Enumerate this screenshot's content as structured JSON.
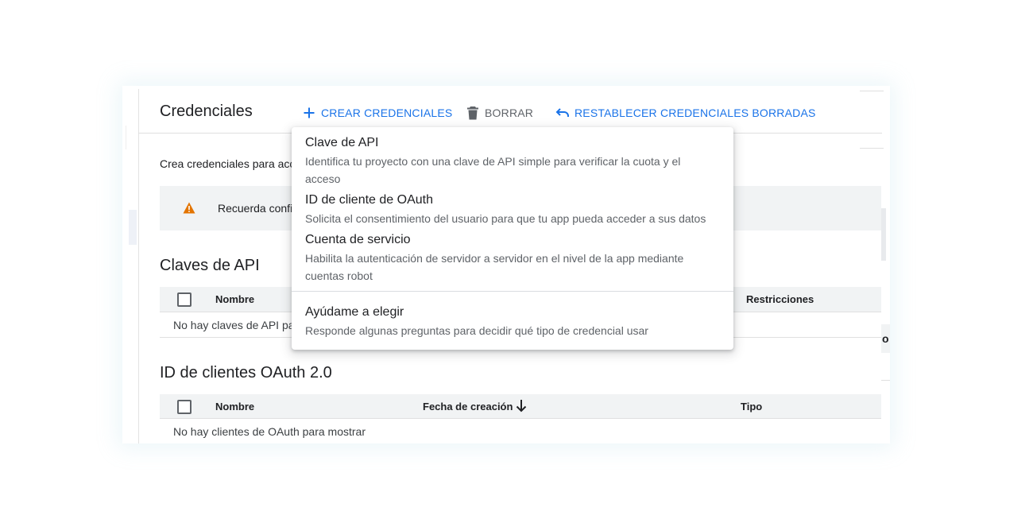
{
  "header": {
    "title": "Credenciales",
    "create_label": "CREAR CREDENCIALES",
    "delete_label": "BORRAR",
    "restore_label": "RESTABLECER CREDENCIALES BORRADAS"
  },
  "intro_text": "Crea credenciales para acc",
  "banner": {
    "text": "Recuerda confi"
  },
  "api_keys": {
    "title": "Claves de API",
    "col_name": "Nombre",
    "col_restrictions": "Restricciones",
    "empty": "No hay claves de API pa",
    "edge_char": "o"
  },
  "oauth": {
    "title": "ID de clientes OAuth 2.0",
    "col_name": "Nombre",
    "col_date": "Fecha de creación",
    "col_type": "Tipo",
    "empty": "No hay clientes de OAuth para mostrar"
  },
  "menu": {
    "items": [
      {
        "title": "Clave de API",
        "desc": "Identifica tu proyecto con una clave de API simple para verificar la cuota y el acceso"
      },
      {
        "title": "ID de cliente de OAuth",
        "desc": "Solicita el consentimiento del usuario para que tu app pueda acceder a sus datos"
      },
      {
        "title": "Cuenta de servicio",
        "desc": "Habilita la autenticación de servidor a servidor en el nivel de la app mediante cuentas robot"
      },
      {
        "title": "Ayúdame a elegir",
        "desc": "Responde algunas preguntas para decidir qué tipo de credencial usar"
      }
    ]
  },
  "colors": {
    "accent": "#1a73e8",
    "warning": "#e37400",
    "surface": "#f1f3f4"
  }
}
